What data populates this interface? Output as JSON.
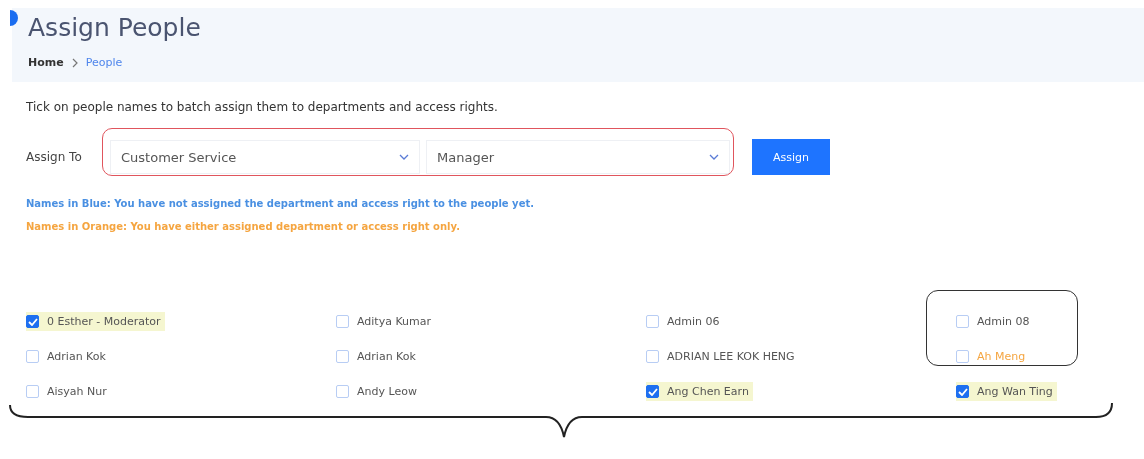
{
  "page": {
    "title": "Assign People"
  },
  "breadcrumb": [
    {
      "label": "Home",
      "selected": false
    },
    {
      "label": "People",
      "selected": true
    }
  ],
  "description": "Tick on people names to batch assign them to departments and access rights.",
  "assign": {
    "label": "Assign To",
    "department": "Customer Service",
    "access_right": "Manager",
    "button": "Assign"
  },
  "legend": [
    {
      "text": "Names in Blue: You have not assigned the department and access right to the people yet.",
      "color": "#4a90e2"
    },
    {
      "text": "Names in Orange: You have either assigned department or access right only.",
      "color": "#f5a540"
    }
  ],
  "people": [
    {
      "name": "0 Esther - Moderator",
      "checked": true,
      "color": "#555555"
    },
    {
      "name": "Aditya Kumar",
      "checked": false,
      "color": "#555555"
    },
    {
      "name": "Admin 06",
      "checked": false,
      "color": "#555555"
    },
    {
      "name": "Admin 08",
      "checked": false,
      "color": "#555555"
    },
    {
      "name": "Adrian Kok",
      "checked": false,
      "color": "#555555"
    },
    {
      "name": "Adrian Kok",
      "checked": false,
      "color": "#555555"
    },
    {
      "name": "ADRIAN LEE KOK HENG",
      "checked": false,
      "color": "#555555"
    },
    {
      "name": "Ah Meng",
      "checked": false,
      "color": "#f5a540"
    },
    {
      "name": "Aisyah Nur",
      "checked": false,
      "color": "#555555"
    },
    {
      "name": "Andy Leow",
      "checked": false,
      "color": "#555555"
    },
    {
      "name": "Ang Chen Earn",
      "checked": true,
      "color": "#555555"
    },
    {
      "name": "Ang Wan Ting",
      "checked": true,
      "color": "#555555"
    }
  ]
}
